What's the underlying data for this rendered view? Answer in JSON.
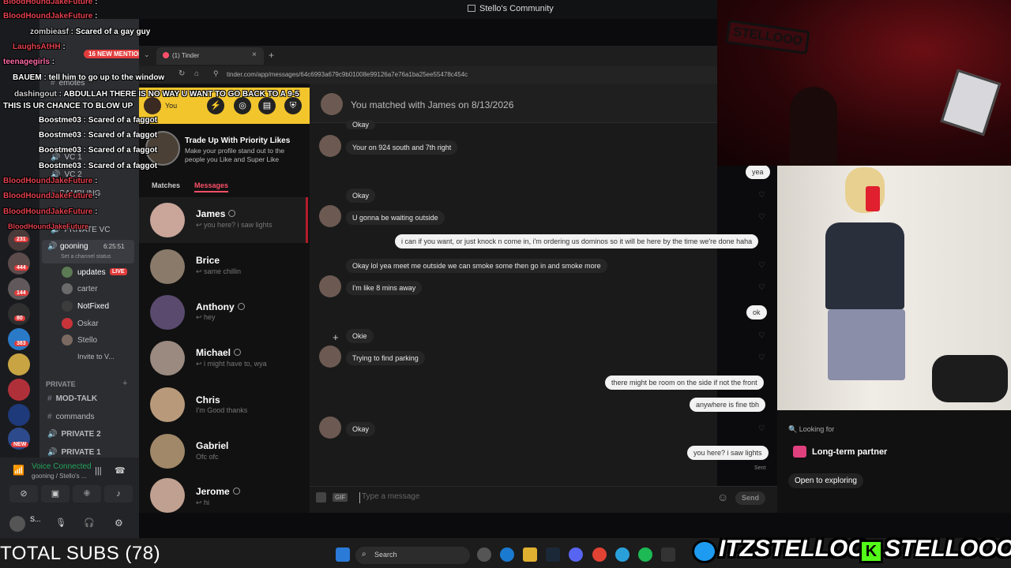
{
  "window": {
    "title": "Stello's Community"
  },
  "browser": {
    "tab_count": "(1)",
    "tab_title": "Tinder",
    "url": "tinder.com/app/messages/64c6993a679c9b01008e99126a7e76a1ba25ee55478c454c"
  },
  "tinder": {
    "you_label": "You",
    "promo_title": "Trade Up With Priority Likes",
    "promo_text": "Make your profile stand out to the people you Like and Super Like",
    "tabs": [
      "Matches",
      "Messages"
    ],
    "conversations": [
      {
        "name": "James",
        "preview": "you here? i saw lights",
        "verified": true
      },
      {
        "name": "Brice",
        "preview": "same chillin",
        "verified": false
      },
      {
        "name": "Anthony",
        "preview": "hey",
        "verified": true
      },
      {
        "name": "Michael",
        "preview": "i might have to, wya",
        "verified": true
      },
      {
        "name": "Chris",
        "preview": "I'm Good thanks",
        "verified": false
      },
      {
        "name": "Gabriel",
        "preview": "Ofc ofc",
        "verified": false
      },
      {
        "name": "Jerome",
        "preview": "hi",
        "verified": true
      }
    ],
    "match_header": "You matched with James on 8/13/2026",
    "messages": [
      {
        "side": "in",
        "text": "Okay"
      },
      {
        "side": "in",
        "text": "Your on 924 south and 7th right"
      },
      {
        "side": "out",
        "text": "yea"
      },
      {
        "side": "in",
        "text": "Okay"
      },
      {
        "side": "in",
        "text": "U gonna be waiting outside"
      },
      {
        "side": "out",
        "text": "i can if you want, or just knock n come in, i'm ordering us dominos so it will be here by the time we're done haha"
      },
      {
        "side": "in",
        "text": "Okay lol yea meet me outside we can smoke some then go in and smoke more"
      },
      {
        "side": "in",
        "text": "I'm like 8 mins away"
      },
      {
        "side": "out",
        "text": "ok"
      },
      {
        "side": "in",
        "text": "Okie"
      },
      {
        "side": "in",
        "text": "Trying to find parking"
      },
      {
        "side": "out",
        "text": "there might be room on the side if not the front"
      },
      {
        "side": "out",
        "text": "anywhere is fine tbh"
      },
      {
        "side": "in",
        "text": "Okay"
      },
      {
        "side": "out",
        "text": "you here? i saw lights"
      }
    ],
    "sent_label": "Sent",
    "input_placeholder": "Type a message",
    "gif_label": "GIF",
    "send_label": "Send",
    "looking_for_label": "Looking for",
    "looking_for_value": "Long-term partner",
    "open_to": "Open to exploring"
  },
  "discord": {
    "channels_top": [
      "emotes",
      "VC 1",
      "VC 2",
      "GAMBLING",
      "PRIVATE VC"
    ],
    "mentions_badge": "16 NEW MENTIONS",
    "voice_channel": "gooning",
    "voice_time": "6:25:51",
    "channel_status": "Set a channel status",
    "voice_members": [
      "updates",
      "carter",
      "NotFixed",
      "Oskar",
      "Stello",
      "Invite to V..."
    ],
    "live_badge": "LIVE",
    "private_header": "PRIVATE",
    "private_channels": [
      "MOD-TALK",
      "commands",
      "PRIVATE 2",
      "PRIVATE 1"
    ],
    "voice_connected": "Voice Connected",
    "voice_connected_sub": "gooning / Stello's ...",
    "user_short": "S...",
    "server_badges": [
      "231",
      "444",
      "144",
      "80",
      "383",
      "NEW"
    ]
  },
  "overlay_chat": [
    {
      "user": "BloodHoundJakeFuture",
      "msg": "",
      "color": "#e0414e"
    },
    {
      "user": "BloodHoundJakeFuture",
      "msg": "",
      "color": "#e0414e"
    },
    {
      "user": "zombieasf",
      "msg": "Scared of a gay guy",
      "color": "#cfcfcf"
    },
    {
      "user": "LaughsAtHH",
      "msg": "",
      "color": "#e0414e"
    },
    {
      "user": "teenagegirls",
      "msg": "",
      "color": "#ff6aa8"
    },
    {
      "user": "BAUEM",
      "msg": "tell him to go up to the window",
      "color": "#ffffff"
    },
    {
      "user": "dashingout",
      "msg": "ABDULLAH THERE IS NO WAY U WANT TO GO BACK TO A 9-5 THIS IS UR CHANCE TO BLOW UP",
      "color": "#cfcfcf"
    },
    {
      "user": "Boostme03",
      "msg": "Scared of a faggot",
      "color": "#ffffff"
    },
    {
      "user": "Boostme03",
      "msg": "Scared of a faggot",
      "color": "#ffffff"
    },
    {
      "user": "Boostme03",
      "msg": "Scared of a faggot",
      "color": "#ffffff"
    },
    {
      "user": "Boostme03",
      "msg": "Scared of a faggot",
      "color": "#ffffff"
    },
    {
      "user": "BloodHoundJakeFuture",
      "msg": "",
      "color": "#e0414e"
    },
    {
      "user": "BloodHoundJakeFuture",
      "msg": "",
      "color": "#e0414e"
    },
    {
      "user": "BloodHoundJakeFuture",
      "msg": "",
      "color": "#e0414e"
    },
    {
      "user": "BloodHoundJakeFuture",
      "msg": "",
      "color": "#e0414e"
    }
  ],
  "webcam_sign": "STELLOOO",
  "taskbar": {
    "subs": "TOTAL SUBS (78)",
    "search": "Search"
  },
  "brand": {
    "twitter": "ITZSTELLOO",
    "kick": "STELLOOO"
  },
  "colors": {
    "tinder_yellow": "#f2c52d",
    "live_red": "#e23c3c",
    "discord_green": "#23a55a",
    "kick_green": "#53fc18"
  }
}
